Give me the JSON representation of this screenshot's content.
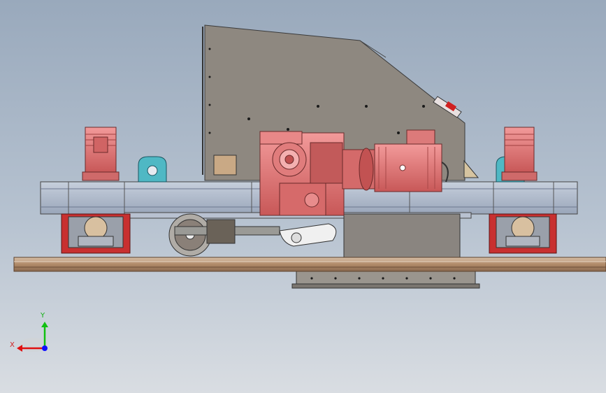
{
  "viewport": {
    "axes": {
      "x_label": "X",
      "y_label": "Y"
    }
  },
  "colors": {
    "background_top": "#99a9bc",
    "background_bottom": "#d9dde2",
    "motor_red": "#e8787a",
    "housing_gray": "#8e8880",
    "frame_blue_gray": "#a9b4c8",
    "lifting_lug_cyan": "#4fb8c4",
    "bearing_red": "#c83030",
    "rail_brown": "#b08a68",
    "axis_x": "#e01010",
    "axis_y": "#10c010",
    "axis_z": "#1010ff"
  },
  "icons": {
    "triad": "coordinate-triad-icon"
  }
}
